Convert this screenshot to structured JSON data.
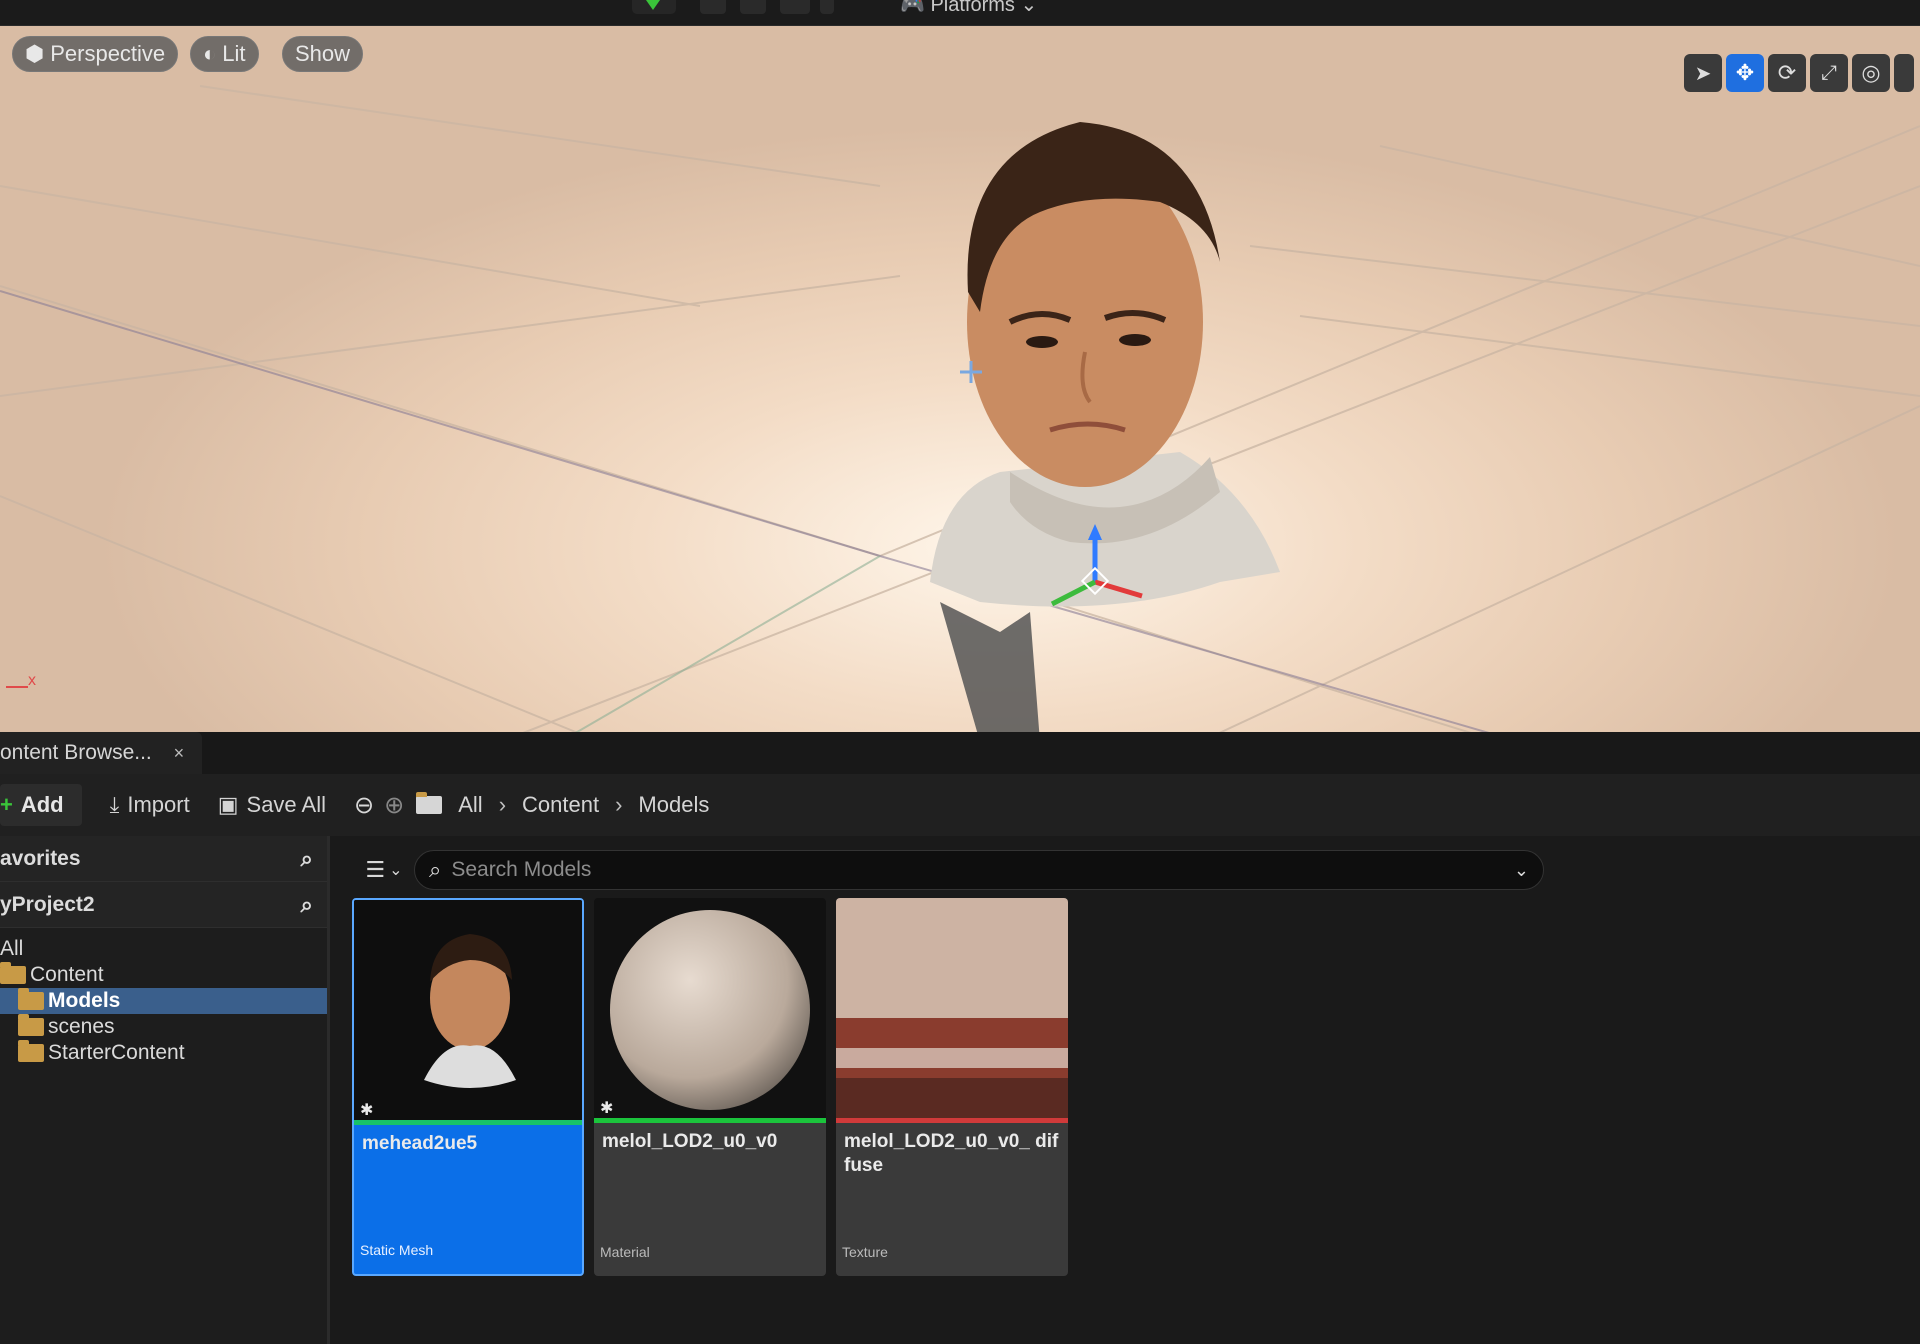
{
  "toolbar": {
    "platforms_label": "Platforms"
  },
  "viewport": {
    "perspective_label": "Perspective",
    "lit_label": "Lit",
    "show_label": "Show",
    "axis_label": "x"
  },
  "content_browser": {
    "tab_label": "ontent Browse...",
    "tab_close": "×",
    "add_label": "Add",
    "import_label": "Import",
    "save_all_label": "Save All",
    "breadcrumb": [
      "All",
      "Content",
      "Models"
    ],
    "favorites_label": "avorites",
    "project_label": "yProject2",
    "tree": [
      {
        "label": "All",
        "indent": 0,
        "folder": false,
        "selected": false
      },
      {
        "label": "Content",
        "indent": 0,
        "folder": true,
        "selected": false
      },
      {
        "label": "Models",
        "indent": 1,
        "folder": true,
        "selected": true
      },
      {
        "label": "scenes",
        "indent": 1,
        "folder": true,
        "selected": false
      },
      {
        "label": "StarterContent",
        "indent": 1,
        "folder": true,
        "selected": false
      }
    ],
    "search_placeholder": "Search Models",
    "assets": [
      {
        "name": "mehead2ue5",
        "type": "Static Mesh",
        "type_color": "#18c26a",
        "selected": true
      },
      {
        "name": "melol_LOD2_u0_v0",
        "type": "Material",
        "type_color": "#1bc43c",
        "selected": false
      },
      {
        "name": "melol_LOD2_u0_v0_ diffuse",
        "type": "Texture",
        "type_color": "#d03a3a",
        "selected": false
      }
    ]
  },
  "colors": {
    "accent": "#0b6fe8",
    "selection": "#3a5f8c",
    "panel": "#1d1d1d"
  }
}
